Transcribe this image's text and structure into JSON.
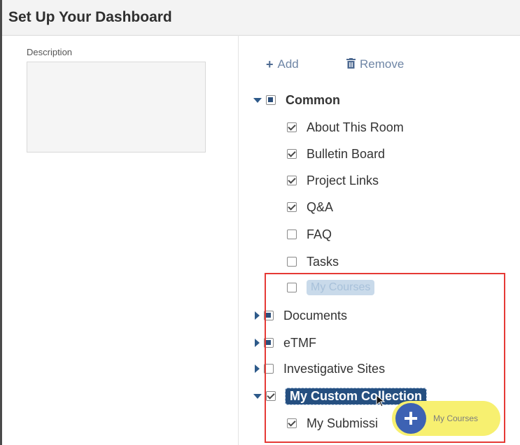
{
  "header": {
    "title": "Set Up Your Dashboard"
  },
  "left_panel": {
    "description_label": "Description"
  },
  "toolbar": {
    "add_label": "Add",
    "remove_label": "Remove"
  },
  "tree": {
    "common": {
      "label": "Common",
      "state": "partial",
      "expanded": true
    },
    "common_items": [
      {
        "label": "About This Room",
        "checked": true
      },
      {
        "label": "Bulletin Board",
        "checked": true
      },
      {
        "label": "Project Links",
        "checked": true
      },
      {
        "label": "Q&A",
        "checked": true
      },
      {
        "label": "FAQ",
        "checked": false
      },
      {
        "label": "Tasks",
        "checked": false
      }
    ],
    "ghost_item": {
      "label": "My Courses",
      "checked": false
    },
    "documents": {
      "label": "Documents",
      "state": "partial",
      "expanded": false
    },
    "etmf": {
      "label": "eTMF",
      "state": "partial",
      "expanded": false
    },
    "investigative_sites": {
      "label": "Investigative Sites",
      "state": "unchecked",
      "expanded": false
    },
    "custom_collection": {
      "label": "My Custom Collection",
      "state": "checked",
      "expanded": true,
      "selected": true
    },
    "my_submissions": {
      "label": "My Submissi",
      "checked": true
    }
  },
  "drag_overlay": {
    "label": "My Courses",
    "icon": "plus-icon"
  },
  "colors": {
    "accent": "#254f80",
    "highlight_box": "#e53935",
    "drag_pill": "#f7f070",
    "plus_circle": "#3d62b3"
  }
}
